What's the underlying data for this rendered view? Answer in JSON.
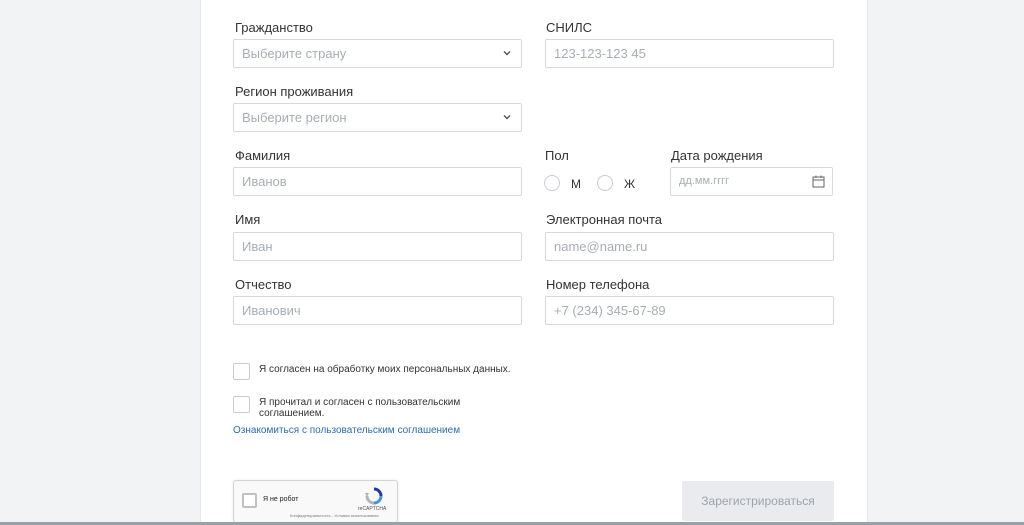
{
  "form": {
    "citizenship": {
      "label": "Гражданство",
      "placeholder": "Выберите страну"
    },
    "snils": {
      "label": "СНИЛС",
      "placeholder": "123-123-123 45"
    },
    "region": {
      "label": "Регион проживания",
      "placeholder": "Выберите регион"
    },
    "last_name": {
      "label": "Фамилия",
      "placeholder": "Иванов"
    },
    "gender": {
      "label": "Пол",
      "options": [
        "М",
        "Ж"
      ]
    },
    "birth_date": {
      "label": "Дата рождения",
      "placeholder": "дд.мм.гггг"
    },
    "first_name": {
      "label": "Имя",
      "placeholder": "Иван"
    },
    "email": {
      "label": "Электронная почта",
      "placeholder": "name@name.ru"
    },
    "patronymic": {
      "label": "Отчество",
      "placeholder": "Иванович"
    },
    "phone": {
      "label": "Номер телефона",
      "placeholder": "+7 (234) 345-67-89"
    }
  },
  "consents": {
    "personal_data": "Я согласен на обработку моих персональных данных.",
    "user_agreement_line1": "Я прочитал и согласен с пользовательским",
    "user_agreement_line2": "соглашением.",
    "agreement_link": "Ознакомиться с пользовательским соглашением"
  },
  "recaptcha": {
    "label": "Я не робот",
    "brand": "reCAPTCHA",
    "terms": "Конфиденциальность - Условия использования"
  },
  "submit_label": "Зарегистрироваться",
  "colors": {
    "link": "#2b6cb0",
    "recaptcha_blue": "#1c3aa9"
  }
}
